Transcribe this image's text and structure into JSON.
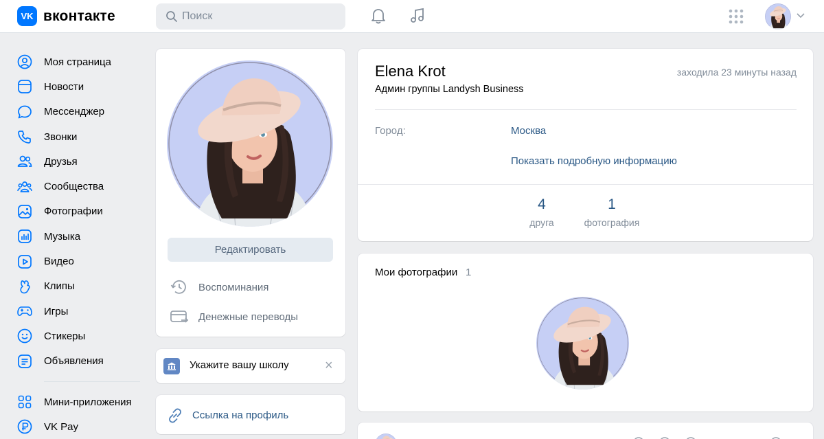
{
  "header": {
    "logo_badge": "VK",
    "logo_text": "вконтакте",
    "search_placeholder": "Поиск",
    "icons": [
      "bell-icon",
      "music-icon",
      "apps-grid-icon",
      "chevron-down-icon"
    ]
  },
  "sidebar": {
    "items": [
      {
        "label": "Моя страница",
        "icon": "user-circle-icon"
      },
      {
        "label": "Новости",
        "icon": "news-icon"
      },
      {
        "label": "Мессенджер",
        "icon": "message-icon"
      },
      {
        "label": "Звонки",
        "icon": "phone-icon"
      },
      {
        "label": "Друзья",
        "icon": "friends-icon"
      },
      {
        "label": "Сообщества",
        "icon": "communities-icon"
      },
      {
        "label": "Фотографии",
        "icon": "photo-icon"
      },
      {
        "label": "Музыка",
        "icon": "music-icon"
      },
      {
        "label": "Видео",
        "icon": "video-icon"
      },
      {
        "label": "Клипы",
        "icon": "clips-icon"
      },
      {
        "label": "Игры",
        "icon": "gamepad-icon"
      },
      {
        "label": "Стикеры",
        "icon": "smile-icon"
      },
      {
        "label": "Объявления",
        "icon": "ads-icon"
      }
    ],
    "extra_items": [
      {
        "label": "Мини-приложения",
        "icon": "apps-icon"
      },
      {
        "label": "VK Pay",
        "icon": "vkpay-icon"
      }
    ]
  },
  "avatar_card": {
    "edit_label": "Редактировать",
    "memories_label": "Воспоминания",
    "transfers_label": "Денежные переводы"
  },
  "school_card": {
    "text": "Укажите вашу школу",
    "close": "×"
  },
  "link_card": {
    "text": "Ссылка на профиль"
  },
  "profile": {
    "name": "Elena Krot",
    "last_seen": "заходила 23 минуты назад",
    "status": "Админ группы Landysh Business",
    "city_label": "Город:",
    "city_value": "Москва",
    "more_info": "Показать подробную информацию",
    "counters": [
      {
        "value": "4",
        "label": "друга"
      },
      {
        "value": "1",
        "label": "фотография"
      }
    ]
  },
  "photos_card": {
    "title": "Мои фотографии",
    "count": "1"
  },
  "colors": {
    "brand": "#0077ff",
    "link": "#2a5885",
    "muted": "#818c99",
    "page_bg": "#edeef0",
    "avatar_bg": "#c6cff5"
  }
}
